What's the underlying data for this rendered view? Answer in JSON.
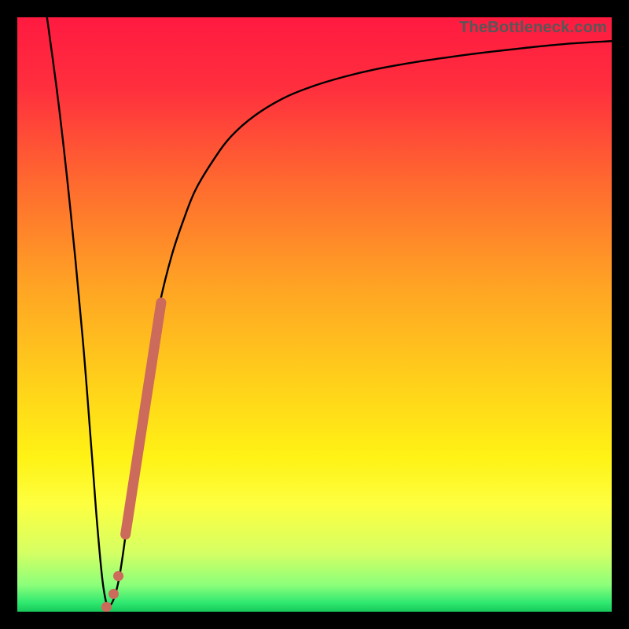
{
  "watermark": "TheBottleneck.com",
  "gradient_stops": [
    {
      "offset": 0.0,
      "color": "#ff1a40"
    },
    {
      "offset": 0.12,
      "color": "#ff2f3e"
    },
    {
      "offset": 0.28,
      "color": "#ff6a2f"
    },
    {
      "offset": 0.45,
      "color": "#ffa324"
    },
    {
      "offset": 0.62,
      "color": "#ffd21a"
    },
    {
      "offset": 0.74,
      "color": "#fff215"
    },
    {
      "offset": 0.82,
      "color": "#fdff40"
    },
    {
      "offset": 0.9,
      "color": "#d6ff63"
    },
    {
      "offset": 0.955,
      "color": "#8cff7a"
    },
    {
      "offset": 0.985,
      "color": "#2fe870"
    },
    {
      "offset": 1.0,
      "color": "#17c95a"
    }
  ],
  "chart_data": {
    "type": "line",
    "title": "",
    "xlabel": "",
    "ylabel": "",
    "xlim": [
      0,
      100
    ],
    "ylim": [
      0,
      100
    ],
    "series": [
      {
        "name": "bottleneck-curve",
        "x": [
          5,
          7,
          9,
          11,
          12.5,
          13.5,
          14.5,
          15.5,
          17,
          18.5,
          20,
          22,
          24,
          26,
          28,
          30,
          33,
          36,
          40,
          45,
          50,
          55,
          60,
          66,
          72,
          78,
          85,
          92,
          100
        ],
        "y": [
          100,
          85,
          67,
          46,
          27,
          14,
          4,
          1,
          5,
          15,
          27,
          41,
          52,
          60,
          66,
          71,
          76,
          80,
          83.5,
          86.5,
          88.5,
          90,
          91.2,
          92.3,
          93.2,
          94,
          94.8,
          95.5,
          96
        ]
      }
    ],
    "annotations": [
      {
        "name": "highlight-segment-1",
        "shape": "thick-line",
        "color": "#cc6a5c",
        "x": [
          18.2,
          24.2
        ],
        "y": [
          13,
          52
        ]
      },
      {
        "name": "highlight-dash-1",
        "shape": "dot",
        "color": "#cc6a5c",
        "x": 17.0,
        "y": 6.0
      },
      {
        "name": "highlight-dash-2",
        "shape": "dot",
        "color": "#cc6a5c",
        "x": 16.2,
        "y": 3.0
      },
      {
        "name": "highlight-dash-3",
        "shape": "dot",
        "color": "#cc6a5c",
        "x": 15.0,
        "y": 0.8
      }
    ]
  }
}
